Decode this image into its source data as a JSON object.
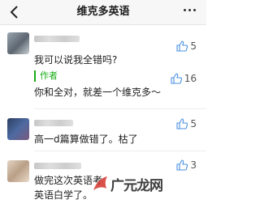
{
  "header": {
    "title": "维克多英语",
    "back_icon": "chevron-left-icon",
    "more_icon": "more-dots-icon"
  },
  "comments": [
    {
      "text": "我可以说我全错吗?",
      "likes": "5",
      "reply": {
        "author": "作者",
        "text": "你和全对，就差一个维克多～",
        "likes": "16"
      }
    },
    {
      "text": "高一d篇算做错了。枯了",
      "likes": "5"
    },
    {
      "text_line1": "做完这次英语考",
      "text_line2": "英语白学了。",
      "likes": "3"
    }
  ],
  "watermark": {
    "text": "广元龙网"
  },
  "colors": {
    "accent_green": "#1aad19",
    "header_bg": "#f7f7f7"
  }
}
